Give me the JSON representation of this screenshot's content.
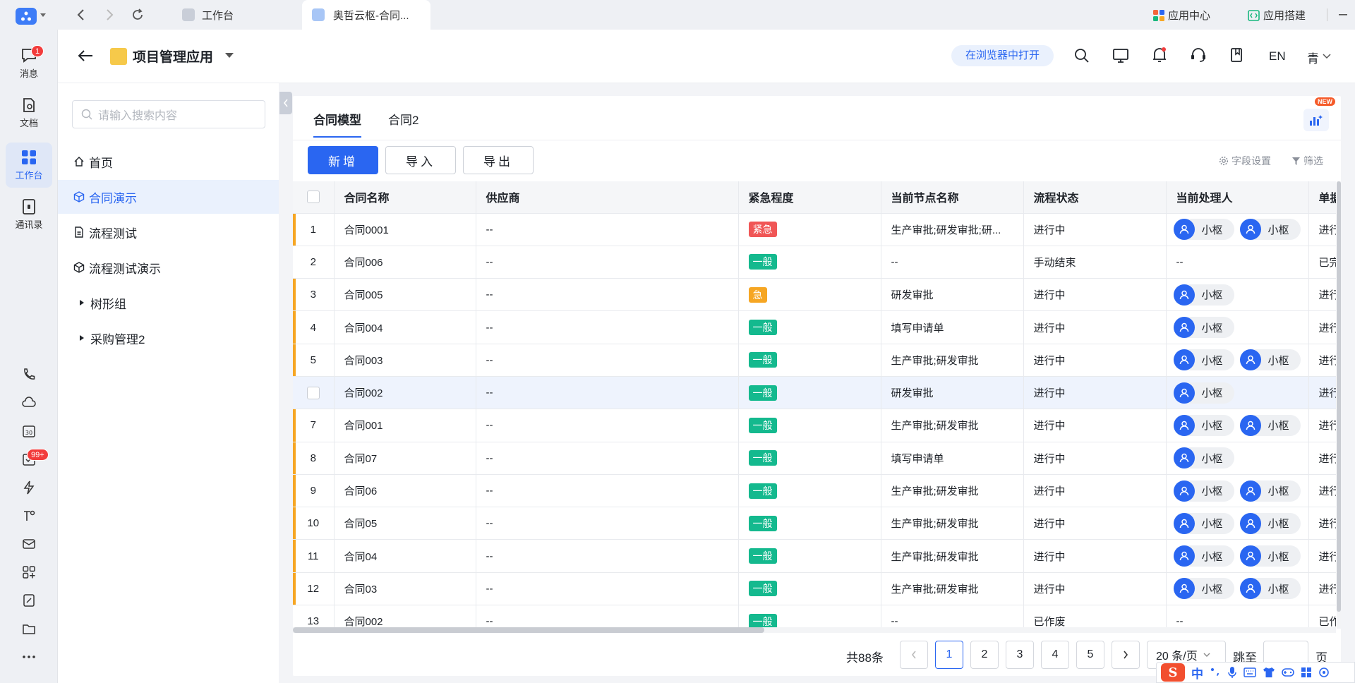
{
  "browser": {
    "tabs": [
      {
        "label": "工作台"
      },
      {
        "label": "奥哲云枢-合同..."
      }
    ],
    "links": {
      "app_center": "应用中心",
      "app_build": "应用搭建"
    }
  },
  "rail": {
    "items": [
      {
        "label": "消息",
        "badge": "1"
      },
      {
        "label": "文档"
      },
      {
        "label": "工作台"
      },
      {
        "label": "通讯录"
      }
    ],
    "tools_badge": "99+"
  },
  "header": {
    "title": "项目管理应用",
    "open_browser": "在浏览器中打开",
    "lang": "EN",
    "user": "青"
  },
  "sidenav": {
    "search_placeholder": "请输入搜索内容",
    "items": [
      {
        "label": "首页"
      },
      {
        "label": "合同演示"
      },
      {
        "label": "流程测试"
      },
      {
        "label": "流程测试演示"
      },
      {
        "label": "树形组"
      },
      {
        "label": "采购管理2"
      }
    ]
  },
  "content": {
    "tabs": [
      "合同模型",
      "合同2"
    ],
    "new_badge": "NEW",
    "buttons": {
      "add": "新增",
      "import": "导入",
      "export": "导出"
    },
    "tools": {
      "fields": "字段设置",
      "filter": "筛选"
    },
    "columns": [
      "合同名称",
      "供应商",
      "紧急程度",
      "当前节点名称",
      "流程状态",
      "当前处理人",
      "单据"
    ],
    "user_name": "小枢",
    "rows": [
      {
        "idx": "1",
        "name": "合同0001",
        "vendor": "--",
        "level": "紧急",
        "node": "生产审批;研发审批;研...",
        "status": "进行中",
        "users": 2,
        "extra": "进行"
      },
      {
        "idx": "2",
        "name": "合同006",
        "vendor": "--",
        "level": "一般",
        "node": "--",
        "status": "手动结束",
        "users": 0,
        "extra": "已完"
      },
      {
        "idx": "3",
        "name": "合同005",
        "vendor": "--",
        "level": "急",
        "node": "研发审批",
        "status": "进行中",
        "users": 1,
        "extra": "进行"
      },
      {
        "idx": "4",
        "name": "合同004",
        "vendor": "--",
        "level": "一般",
        "node": "填写申请单",
        "status": "进行中",
        "users": 1,
        "extra": "进行"
      },
      {
        "idx": "5",
        "name": "合同003",
        "vendor": "--",
        "level": "一般",
        "node": "生产审批;研发审批",
        "status": "进行中",
        "users": 2,
        "extra": "进行"
      },
      {
        "idx": "",
        "name": "合同002",
        "vendor": "--",
        "level": "一般",
        "node": "研发审批",
        "status": "进行中",
        "users": 1,
        "extra": "进行"
      },
      {
        "idx": "7",
        "name": "合同001",
        "vendor": "--",
        "level": "一般",
        "node": "生产审批;研发审批",
        "status": "进行中",
        "users": 2,
        "extra": "进行"
      },
      {
        "idx": "8",
        "name": "合同07",
        "vendor": "--",
        "level": "一般",
        "node": "填写申请单",
        "status": "进行中",
        "users": 1,
        "extra": "进行"
      },
      {
        "idx": "9",
        "name": "合同06",
        "vendor": "--",
        "level": "一般",
        "node": "生产审批;研发审批",
        "status": "进行中",
        "users": 2,
        "extra": "进行"
      },
      {
        "idx": "10",
        "name": "合同05",
        "vendor": "--",
        "level": "一般",
        "node": "生产审批;研发审批",
        "status": "进行中",
        "users": 2,
        "extra": "进行"
      },
      {
        "idx": "11",
        "name": "合同04",
        "vendor": "--",
        "level": "一般",
        "node": "生产审批;研发审批",
        "status": "进行中",
        "users": 2,
        "extra": "进行"
      },
      {
        "idx": "12",
        "name": "合同03",
        "vendor": "--",
        "level": "一般",
        "node": "生产审批;研发审批",
        "status": "进行中",
        "users": 2,
        "extra": "进行"
      },
      {
        "idx": "13",
        "name": "合同002",
        "vendor": "--",
        "level": "一般",
        "node": "--",
        "status": "已作废",
        "users": 0,
        "extra": "已作"
      }
    ],
    "pagination": {
      "total": "共88条",
      "pages": [
        "1",
        "2",
        "3",
        "4",
        "5"
      ],
      "page_size": "20 条/页",
      "jump": "跳至",
      "page_unit": "页"
    }
  },
  "ime": {
    "lang": "中"
  }
}
